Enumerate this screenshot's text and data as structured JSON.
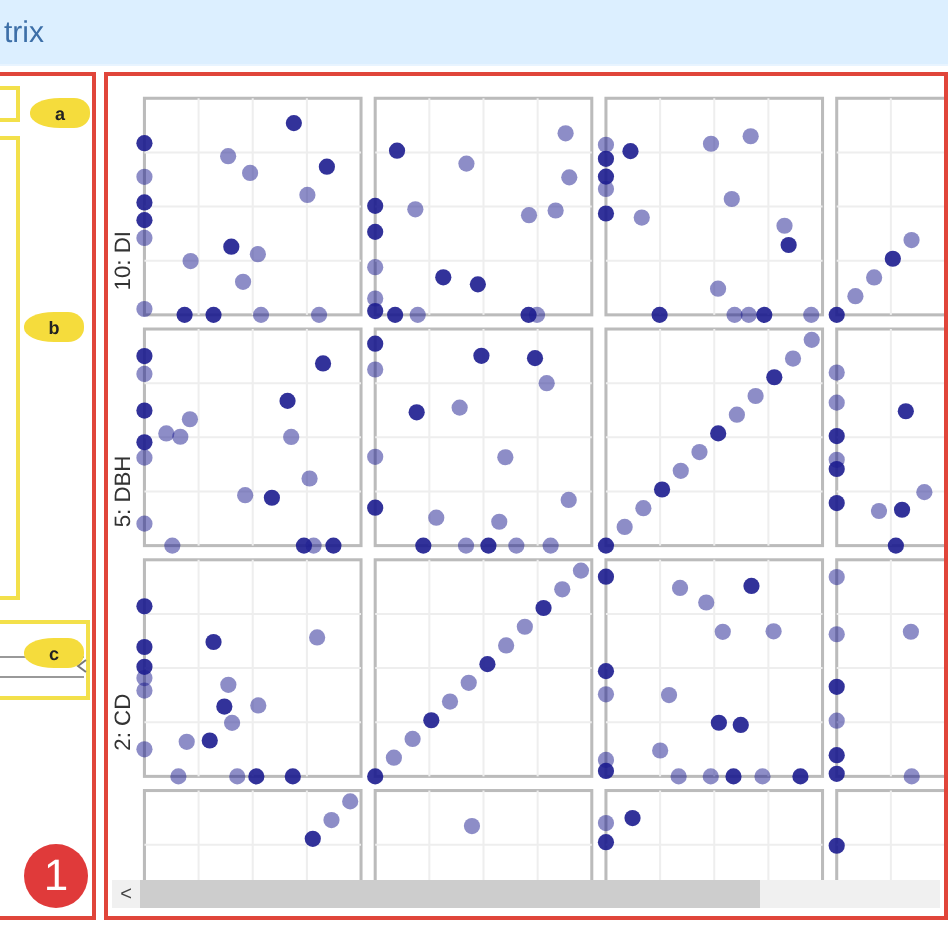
{
  "window": {
    "title": "trix"
  },
  "callouts": [
    {
      "label": "a"
    },
    {
      "label": "b"
    },
    {
      "label": "c"
    }
  ],
  "panel_marker": {
    "label": "1"
  },
  "matrix": {
    "row_labels": [
      "10: DI",
      "5: DBH",
      "2: CD"
    ]
  },
  "scrollbar": {
    "arrow": "<"
  }
}
